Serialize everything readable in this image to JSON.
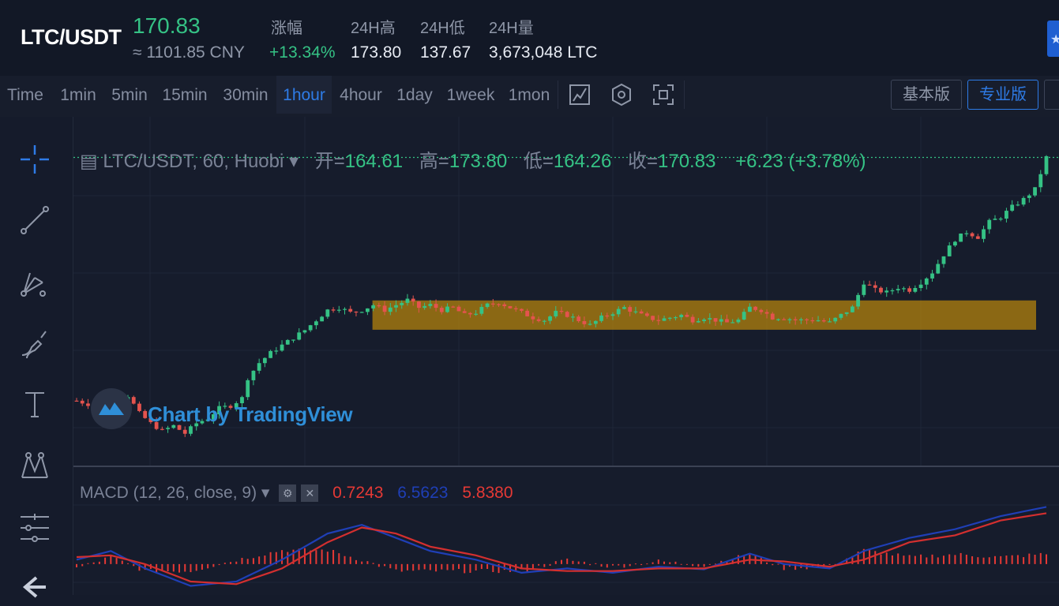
{
  "ticker": {
    "pair": "LTC/USDT",
    "last_price": "170.83",
    "cny_price": "≈ 1101.85 CNY",
    "stats": [
      {
        "label": "涨幅",
        "value": "+13.34%",
        "up": true
      },
      {
        "label": "24H高",
        "value": "173.80",
        "up": false
      },
      {
        "label": "24H低",
        "value": "137.67",
        "up": false
      },
      {
        "label": "24H量",
        "value": "3,673,048 LTC",
        "up": false
      }
    ],
    "colors": {
      "up": "#35c285",
      "down": "#e4534e"
    }
  },
  "toolbar": {
    "intervals": [
      "Time",
      "1min",
      "5min",
      "15min",
      "30min",
      "1hour",
      "4hour",
      "1day",
      "1week",
      "1mon"
    ],
    "active_interval": "1hour",
    "icons": [
      "chart-type-icon",
      "indicators-icon",
      "screenshot-icon"
    ],
    "version_basic": "基本版",
    "version_pro": "专业版"
  },
  "left_tools": [
    "crosshair-icon",
    "trend-line-icon",
    "pitchfork-icon",
    "brush-icon",
    "text-icon",
    "pattern-icon",
    "measure-icon",
    "back-arrow-icon"
  ],
  "legend": {
    "symbol": "LTC/USDT, 60, Huobi",
    "open_label": "开=",
    "open": "164.61",
    "high_label": "高=",
    "high": "173.80",
    "low_label": "低=",
    "low": "164.26",
    "close_label": "收=",
    "close": "170.83",
    "change": "+6.23 (+3.78%)"
  },
  "watermark": "Chart by TradingView",
  "macd": {
    "title": "MACD (12, 26, close, 9)",
    "hist": "0.7243",
    "macd": "6.5623",
    "signal": "5.8380"
  },
  "chart_data": {
    "type": "candlestick",
    "title": "",
    "price_line": "170.83",
    "highlight_range": {
      "low": 138.0,
      "high": 141.0,
      "color": "#b8860b"
    },
    "close_path": [
      [
        0,
        122.5
      ],
      [
        3,
        121.5
      ],
      [
        5,
        124.0
      ],
      [
        7,
        122.0
      ],
      [
        9,
        123.5
      ],
      [
        11,
        120.0
      ],
      [
        13,
        118.0
      ],
      [
        15,
        116.5
      ],
      [
        17,
        117.5
      ],
      [
        19,
        116.0
      ],
      [
        21,
        118.0
      ],
      [
        23,
        119.0
      ],
      [
        25,
        121.0
      ],
      [
        27,
        121.5
      ],
      [
        29,
        123.0
      ],
      [
        30,
        127.0
      ],
      [
        32,
        130.0
      ],
      [
        34,
        132.0
      ],
      [
        36,
        133.5
      ],
      [
        38,
        135.0
      ],
      [
        40,
        136.5
      ],
      [
        42,
        138.5
      ],
      [
        44,
        140.5
      ],
      [
        46,
        141.0
      ],
      [
        48,
        140.0
      ],
      [
        50,
        140.5
      ],
      [
        52,
        141.5
      ],
      [
        54,
        140.5
      ],
      [
        56,
        141.5
      ],
      [
        58,
        142.5
      ],
      [
        60,
        141.0
      ],
      [
        62,
        141.5
      ],
      [
        64,
        140.5
      ],
      [
        66,
        141.0
      ],
      [
        68,
        139.5
      ],
      [
        70,
        140.0
      ],
      [
        72,
        141.5
      ],
      [
        74,
        142.0
      ],
      [
        76,
        141.0
      ],
      [
        78,
        140.0
      ],
      [
        80,
        139.0
      ],
      [
        82,
        138.5
      ],
      [
        84,
        140.0
      ],
      [
        86,
        139.5
      ],
      [
        88,
        138.5
      ],
      [
        90,
        137.5
      ],
      [
        92,
        139.0
      ],
      [
        94,
        140.0
      ],
      [
        96,
        141.0
      ],
      [
        98,
        140.0
      ],
      [
        100,
        139.0
      ],
      [
        102,
        138.5
      ],
      [
        104,
        139.0
      ],
      [
        106,
        139.5
      ],
      [
        108,
        138.5
      ],
      [
        110,
        139.0
      ],
      [
        112,
        138.5
      ],
      [
        114,
        138.0
      ],
      [
        116,
        138.5
      ],
      [
        118,
        141.0
      ],
      [
        120,
        140.5
      ],
      [
        122,
        139.0
      ],
      [
        124,
        139.0
      ],
      [
        126,
        138.5
      ],
      [
        128,
        138.5
      ],
      [
        130,
        138.5
      ],
      [
        132,
        138.0
      ],
      [
        134,
        139.5
      ],
      [
        136,
        141.0
      ],
      [
        138,
        146.0
      ],
      [
        140,
        144.5
      ],
      [
        142,
        144.0
      ],
      [
        144,
        145.0
      ],
      [
        146,
        144.5
      ],
      [
        148,
        146.0
      ],
      [
        150,
        148.0
      ],
      [
        152,
        151.5
      ],
      [
        154,
        154.5
      ],
      [
        156,
        156.0
      ],
      [
        158,
        155.0
      ],
      [
        160,
        158.0
      ],
      [
        162,
        159.0
      ],
      [
        164,
        161.0
      ],
      [
        166,
        162.5
      ],
      [
        168,
        164.5
      ],
      [
        170,
        170.83
      ]
    ],
    "macd": [
      [
        0,
        0.5
      ],
      [
        6,
        1.5
      ],
      [
        12,
        -0.5
      ],
      [
        20,
        -2.5
      ],
      [
        28,
        -2.0
      ],
      [
        36,
        0.5
      ],
      [
        44,
        3.5
      ],
      [
        50,
        4.5
      ],
      [
        56,
        3.0
      ],
      [
        62,
        1.5
      ],
      [
        70,
        0.5
      ],
      [
        78,
        -1.0
      ],
      [
        86,
        -0.5
      ],
      [
        94,
        -1.0
      ],
      [
        102,
        -0.3
      ],
      [
        110,
        -0.6
      ],
      [
        118,
        1.2
      ],
      [
        124,
        0.0
      ],
      [
        132,
        -0.5
      ],
      [
        138,
        1.5
      ],
      [
        146,
        3.0
      ],
      [
        154,
        4.0
      ],
      [
        162,
        5.5
      ],
      [
        170,
        6.5623
      ]
    ],
    "signal": [
      [
        0,
        0.8
      ],
      [
        6,
        1.0
      ],
      [
        12,
        0.0
      ],
      [
        20,
        -2.0
      ],
      [
        28,
        -2.3
      ],
      [
        36,
        -0.5
      ],
      [
        44,
        2.5
      ],
      [
        50,
        4.2
      ],
      [
        56,
        3.5
      ],
      [
        62,
        2.0
      ],
      [
        70,
        1.0
      ],
      [
        78,
        -0.5
      ],
      [
        86,
        -0.8
      ],
      [
        94,
        -0.8
      ],
      [
        102,
        -0.5
      ],
      [
        110,
        -0.5
      ],
      [
        118,
        0.5
      ],
      [
        124,
        0.3
      ],
      [
        132,
        -0.3
      ],
      [
        138,
        0.5
      ],
      [
        146,
        2.5
      ],
      [
        154,
        3.3
      ],
      [
        162,
        5.0
      ],
      [
        170,
        5.838
      ]
    ]
  }
}
